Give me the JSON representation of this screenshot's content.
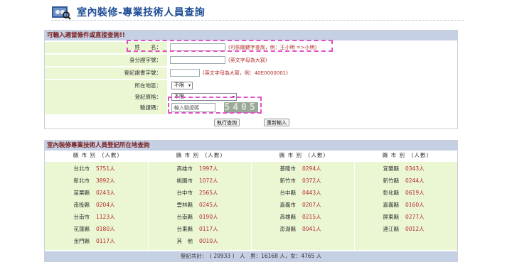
{
  "header": {
    "title": "室內裝修-專業技術人員查詢"
  },
  "search": {
    "title": "可輸入適當條件或直接查詢!!",
    "name_label": "姓　　名：",
    "name_hint": "(可依關鍵字查詢，例：王小明 =>小明)",
    "id_label": "身分證字號：",
    "id_hint": "(英文字母為大寫)",
    "reg_label": "登記證書字號：",
    "reg_hint": "(英文字母為大寫，例：40E0000001)",
    "location_label": "所在地區：",
    "location_value": "不限",
    "qual_label": "登記資格：",
    "qual_value": "不限",
    "captcha_label": "驗證碼：",
    "captcha_placeholder": "輸入驗證碼",
    "captcha_code": "5405",
    "submit_label": "執行查詢",
    "reset_label": "重新輸入"
  },
  "stats": {
    "title": "室內裝修專業技術人員登記所在地查詢",
    "column_header": "縣 市 別　(人數)",
    "rows": [
      [
        {
          "city": "台北市",
          "count": "5751人"
        },
        {
          "city": "高雄市",
          "count": "1997人"
        },
        {
          "city": "基隆市",
          "count": "0294人"
        },
        {
          "city": "宜蘭縣",
          "count": "0343人"
        }
      ],
      [
        {
          "city": "新北市",
          "count": "3892人"
        },
        {
          "city": "桃園市",
          "count": "1072人"
        },
        {
          "city": "新竹市",
          "count": "0372人"
        },
        {
          "city": "新竹縣",
          "count": "0244人"
        }
      ],
      [
        {
          "city": "苗栗縣",
          "count": "0243人"
        },
        {
          "city": "台中市",
          "count": "2565人"
        },
        {
          "city": "台中縣",
          "count": "0443人"
        },
        {
          "city": "彰化縣",
          "count": "0619人"
        }
      ],
      [
        {
          "city": "南投縣",
          "count": "0204人"
        },
        {
          "city": "雲林縣",
          "count": "0245人"
        },
        {
          "city": "嘉義市",
          "count": "0207人"
        },
        {
          "city": "嘉義縣",
          "count": "0160人"
        }
      ],
      [
        {
          "city": "台南市",
          "count": "1123人"
        },
        {
          "city": "台南縣",
          "count": "0190人"
        },
        {
          "city": "高雄縣",
          "count": "0215人"
        },
        {
          "city": "屏東縣",
          "count": "0277人"
        }
      ],
      [
        {
          "city": "花蓮縣",
          "count": "0180人"
        },
        {
          "city": "台東縣",
          "count": "0117人"
        },
        {
          "city": "澎湖縣",
          "count": "0041人"
        },
        {
          "city": "連江縣",
          "count": "0012人"
        }
      ],
      [
        {
          "city": "金門縣",
          "count": "0117人"
        },
        {
          "city": "其　他",
          "count": "0010人"
        }
      ]
    ],
    "total": "登記共計：　( 20933 )　人　男：16168 人，女：4765 人"
  },
  "colors": {
    "header_blue": "#1f4e96",
    "label_bg": "#ebf6d2",
    "title_bg": "#c5d0e4",
    "hint_red": "#b42a2a",
    "highlight": "#e050c8"
  }
}
